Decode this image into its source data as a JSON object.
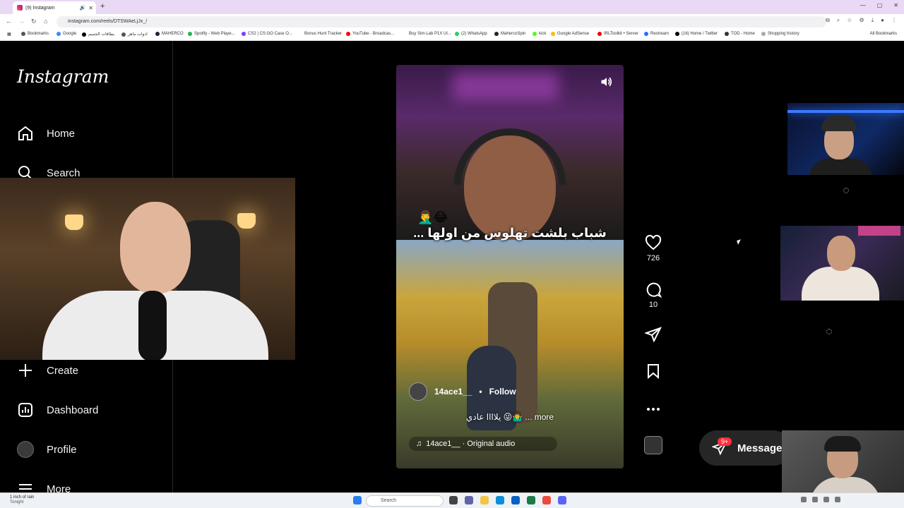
{
  "browser": {
    "tab_title": "(9) Instagram",
    "url": "instagram.com/reels/DTSWAeLjJx_/",
    "bookmarks": [
      "Bookmarks",
      "Google",
      "بطاقات الجسم",
      "ادوات ماهر",
      "MAHERCO",
      "Spotify - Web Playe...",
      "CS2 | CS:GO Case O...",
      "Bonus Hunt Tracker",
      "YouTube - Broadcas...",
      "Buy Sim-Lab P1X Ul...",
      "(2) WhatsApp",
      "MahercoSpin",
      "kick",
      "Google AdSense",
      "IRLToolkit • Server",
      "Restream",
      "(16) Home / Twitter",
      "TOD - Home",
      "Shopping history"
    ],
    "all_bookmarks": "All Bookmarks"
  },
  "sidebar": {
    "logo": "Instagram",
    "items": [
      {
        "label": "Home"
      },
      {
        "label": "Search"
      },
      {
        "label": "Create"
      },
      {
        "label": "Dashboard"
      },
      {
        "label": "Profile"
      },
      {
        "label": "More"
      }
    ]
  },
  "reel": {
    "caption_overlay": "شباب بلشت تهلوس من اولها ...",
    "username": "14ace1__",
    "follow_label": "Follow",
    "description": "يلاااا عادي 😜🤷‍♂️ ... more",
    "audio": "14ace1__ · Original audio",
    "likes": "726",
    "comments": "10"
  },
  "messages": {
    "label": "Message",
    "badge": "9+"
  },
  "taskbar": {
    "weather_title": "1 inch of rain",
    "weather_sub": "Tonight",
    "search_placeholder": "Search"
  },
  "colors": {
    "background": "#000000",
    "accent_badge": "#ff3040",
    "tab_bar": "#e9d9f4"
  }
}
